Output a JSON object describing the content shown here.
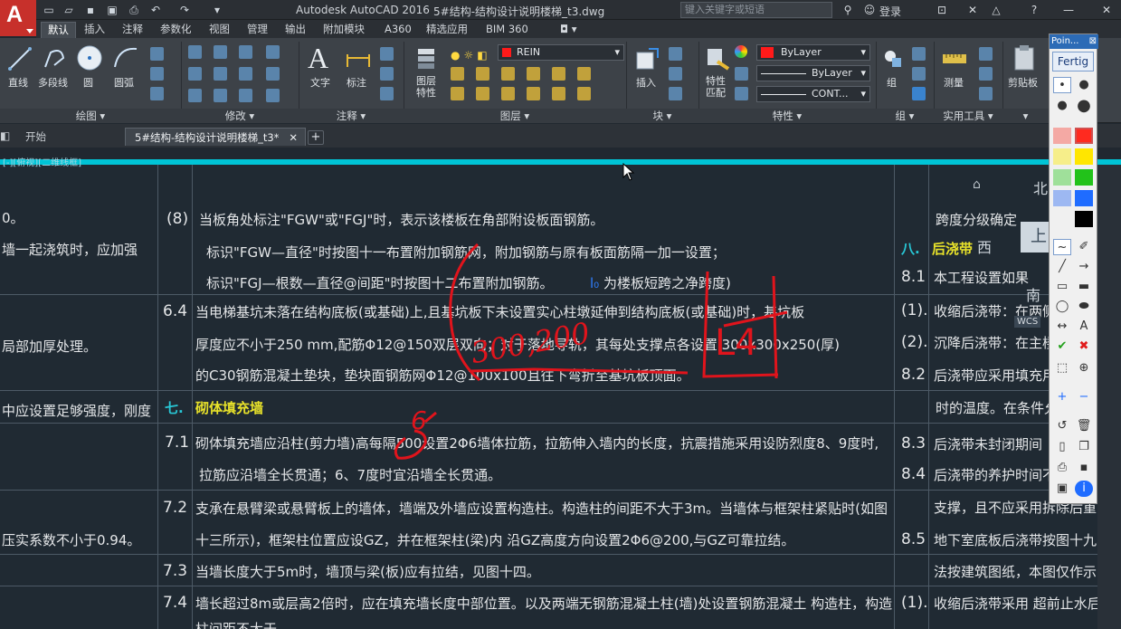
{
  "titlebar": {
    "app": "Autodesk AutoCAD 2016",
    "file": "5#结构-结构设计说明楼梯_t3.dwg",
    "search_placeholder": "键入关键字或短语",
    "login": "登录"
  },
  "ribbon_tabs": [
    "默认",
    "插入",
    "注释",
    "参数化",
    "视图",
    "管理",
    "输出",
    "附加模块",
    "A360",
    "精选应用",
    "BIM 360"
  ],
  "draw_tools": [
    "直线",
    "多段线",
    "圆",
    "圆弧"
  ],
  "panels": [
    "绘图",
    "修改",
    "注释",
    "图层",
    "块",
    "特性",
    "组",
    "实用工具"
  ],
  "tools": {
    "text": "文字",
    "dim": "标注",
    "layer_props": "图层\n特性",
    "insert": "插入",
    "match_props": "特性\n匹配",
    "group": "组",
    "measure": "测量",
    "clipboard": "剪贴板"
  },
  "layer_dropdown": "REIN",
  "props": {
    "color": "ByLayer",
    "linetype": "ByLayer",
    "lineweight": "CONT..."
  },
  "doc_tabs": [
    "开始",
    "5#结构-结构设计说明楼梯_t3*"
  ],
  "viewport_label": "[-][俯视][二维线框]",
  "viewcube": {
    "north": "北",
    "west": "西",
    "south": "南",
    "top": "上",
    "wcs": "WCS"
  },
  "left_col": [
    "0。",
    "墙一起浇筑时，应加强",
    "局部加厚处理。",
    "中应设置足够强度，刚度",
    "压实系数不小于0.94。"
  ],
  "mid": {
    "r1_num": "(8)",
    "r1": "当板角处标注\"FGW\"或\"FGJ\"时，表示该楼板在角部附设板面钢筋。",
    "r2": "标识\"FGW—直径\"时按图十一布置附加钢筋网，附加钢筋与原有板面筋隔一加一设置；",
    "r3": "标识\"FGJ—根数—直径@间距\"时按图十二布置附加钢筋。",
    "r3_note_sym": "l₀",
    "r3_note": "为楼板短跨之净跨度)",
    "s64_num": "6.4",
    "s64_1": "当电梯基坑未落在结构底板(或基础)上,且基坑板下未设置实心柱墩延伸到结构底板(或基础)时，基坑板",
    "s64_2": "厚度应不小于250 mm,配筋Φ12@150双层双向；对于落地导轨，其每处支撑点各设置 300x300x250(厚)",
    "s64_3": "的C30钢筋混凝土垫块，垫块面钢筋网Φ12@100x100且往下弯折至基坑板顶面。",
    "sec7_num": "七.",
    "sec7": "砌体填充墙",
    "s71_num": "7.1",
    "s71_1": "砌体填充墙应沿柱(剪力墙)高每隔500设置2Φ6墙体拉筋，拉筋伸入墙内的长度，抗震措施采用设防烈度8、9度时,",
    "s71_2": "拉筋应沿墙全长贯通；6、7度时宜沿墙全长贯通。",
    "s72_num": "7.2",
    "s72_1": "支承在悬臂梁或悬臂板上的墙体，墙端及外墙应设置构造柱。构造柱的间距不大于3m。当墙体与框架柱紧贴时(如图",
    "s72_2": "十三所示)，框架柱位置应设GZ，并在框架柱(梁)内 沿GZ高度方向设置2Φ6@200,与GZ可靠拉结。",
    "s73_num": "7.3",
    "s73": "当墙长度大于5m时，墙顶与梁(板)应有拉结，见图十四。",
    "s74_num": "7.4",
    "s74": "墙长超过8m或层高2倍时，应在填充墙长度中部位置。以及两端无钢筋混凝土柱(墙)处设置钢筋混凝土 构造柱，构造",
    "s74_cut": "柱间距不大于"
  },
  "right": {
    "r1": "跨度分级确定",
    "sec8_num": "八.",
    "sec8": "后浇带",
    "n81": "8.1",
    "t81": "本工程设置如果",
    "n1": "(1).",
    "t1": "收缩后浇带：在两侧",
    "n2": "(2).",
    "t2": "沉降后浇带：在主楼",
    "n82": "8.2",
    "t82": "后浇带应采用填充用",
    "t82b": "时的温度。在条件允",
    "n83": "8.3",
    "t83": "后浇带未封闭期间",
    "n84": "8.4",
    "t84": "后浇带的养护时间不",
    "t84b": "支撑，且不应采用拆除后重",
    "n85": "8.5",
    "t85": "地下室底板后浇带按图十九、",
    "t85b": "法按建筑图纸，本图仅作示意。",
    "n1b": "(1).",
    "t1b": "收缩后浇带采用 超前止水后浇"
  },
  "ink_annotations": [
    "300,200",
    "L4",
    "6"
  ],
  "palette": {
    "title": "Poin...",
    "button": "Fertig",
    "swatches": [
      "#ff3b30",
      "#ffe600",
      "#22c21a",
      "#1f6cff",
      "#000000"
    ]
  },
  "colors": {
    "accent_cyan": "#00c4d6",
    "ink_red": "#e0141c",
    "section_yellow": "#e8e22a"
  }
}
